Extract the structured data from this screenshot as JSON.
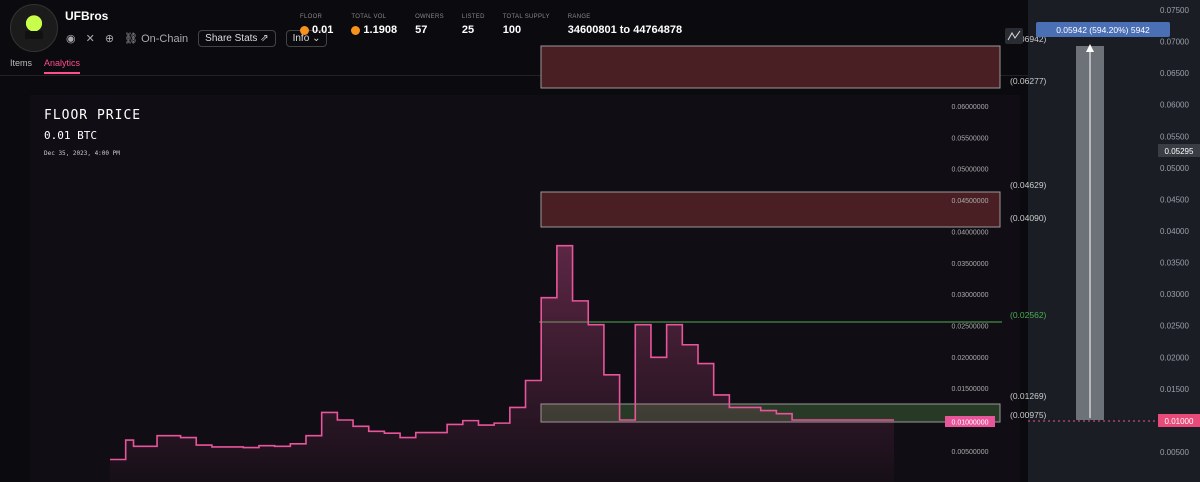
{
  "header": {
    "name": "UFBros",
    "onchain_label": "On-Chain",
    "share_label": "Share Stats",
    "info_label": "Info"
  },
  "stats": [
    {
      "label": "FLOOR",
      "value": "0.01",
      "btc": true
    },
    {
      "label": "TOTAL VOL",
      "value": "1.1908",
      "btc": true
    },
    {
      "label": "OWNERS",
      "value": "57",
      "btc": false
    },
    {
      "label": "LISTED",
      "value": "25",
      "btc": false
    },
    {
      "label": "TOTAL SUPPLY",
      "value": "100",
      "btc": false
    },
    {
      "label": "RANGE",
      "value": "34600801 to 44764878",
      "btc": false
    }
  ],
  "tabs": [
    "Items",
    "Analytics"
  ],
  "chart": {
    "title": "FLOOR PRICE",
    "value": "0.01 BTC",
    "date": "Dec 35, 2023, 4:00 PM",
    "current_label": "0.01000000",
    "colors": {
      "line": "#e8559a",
      "green": "#4caf50",
      "red": "#7a2a2a"
    }
  },
  "levels": [
    "(0.06942)",
    "(0.06277)",
    "(0.04629)",
    "(0.04090)",
    "(0.02562)",
    "(0.01269)",
    "(0.00975)"
  ],
  "overlay": {
    "tooltip": "0.05942 (594.20%) 5942",
    "price_badge": "0.05295",
    "current_badge": "0.01000"
  },
  "chart_data": {
    "type": "line",
    "y_ticks": [
      "0.00500000",
      "0.01000000",
      "0.01500000",
      "0.02000000",
      "0.02500000",
      "0.03000000",
      "0.03500000",
      "0.04000000",
      "0.04500000",
      "0.05000000",
      "0.05500000",
      "0.06000000"
    ],
    "y_ticks_right": [
      "0.00500",
      "0.01000",
      "0.01500",
      "0.02000",
      "0.02500",
      "0.03000",
      "0.03500",
      "0.04000",
      "0.04500",
      "0.05000",
      "0.05500",
      "0.06000",
      "0.06500",
      "0.07000",
      "0.07500"
    ],
    "x": [
      0,
      2,
      3,
      6,
      7,
      9,
      11,
      13,
      15,
      17,
      19,
      21,
      23,
      25,
      27,
      29,
      31,
      33,
      35,
      37,
      39,
      41,
      43,
      45,
      47,
      49,
      51,
      53,
      55,
      57,
      59,
      61,
      63,
      65,
      67,
      69,
      71,
      73,
      75,
      77,
      79,
      81,
      83,
      85,
      87,
      89,
      91,
      93,
      95,
      97,
      99,
      100
    ],
    "y": [
      0.0037,
      0.0068,
      0.0058,
      0.0075,
      0.0075,
      0.0072,
      0.006,
      0.0057,
      0.0057,
      0.0056,
      0.0059,
      0.0058,
      0.0062,
      0.0075,
      0.0112,
      0.01,
      0.009,
      0.0082,
      0.0079,
      0.0072,
      0.008,
      0.008,
      0.0093,
      0.0099,
      0.0092,
      0.0095,
      0.012,
      0.0163,
      0.0295,
      0.0378,
      0.029,
      0.0252,
      0.0172,
      0.01,
      0.0252,
      0.02,
      0.0252,
      0.022,
      0.019,
      0.014,
      0.012,
      0.012,
      0.0115,
      0.011,
      0.01,
      0.01,
      0.01,
      0.01,
      0.01,
      0.01,
      0.01,
      0.01
    ]
  }
}
